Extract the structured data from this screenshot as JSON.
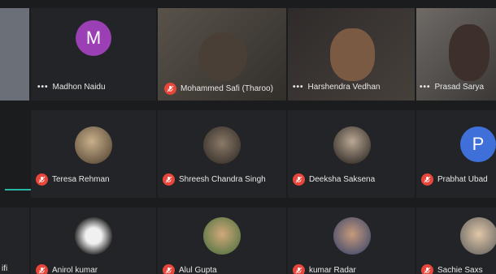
{
  "participants": [
    {
      "id": "p0",
      "name": "",
      "kind": "video",
      "status": "none"
    },
    {
      "id": "p1",
      "name": "Madhon Naidu",
      "kind": "letter",
      "letter": "M",
      "avatar_color": "#9b3fb4",
      "status": "more"
    },
    {
      "id": "p2",
      "name": "Mohammed Safi (Tharoo)",
      "kind": "video",
      "status": "muted"
    },
    {
      "id": "p3",
      "name": "Harshendra Vedhan",
      "kind": "video",
      "status": "more"
    },
    {
      "id": "p4",
      "name": "Prasad Sarya",
      "kind": "video",
      "status": "more"
    },
    {
      "id": "p5",
      "name": "Teresa Rehman",
      "kind": "photo",
      "status": "muted"
    },
    {
      "id": "p6",
      "name": "Shreesh Chandra Singh",
      "kind": "photo",
      "status": "muted"
    },
    {
      "id": "p7",
      "name": "Deeksha Saksena",
      "kind": "photo",
      "status": "muted"
    },
    {
      "id": "p8",
      "name": "Prabhat Ubad",
      "kind": "letter",
      "letter": "P",
      "avatar_color": "#3f6fd8",
      "status": "muted"
    },
    {
      "id": "p9",
      "name": "Anirol kumar",
      "kind": "photo",
      "status": "muted"
    },
    {
      "id": "p10",
      "name": "Alul Gupta",
      "kind": "photo",
      "status": "muted"
    },
    {
      "id": "p11",
      "name": "kumar Radar",
      "kind": "photo",
      "status": "muted"
    },
    {
      "id": "p12",
      "name": "Sachie Saxs",
      "kind": "photo",
      "status": "muted"
    },
    {
      "id": "p13",
      "name": "ifi",
      "kind": "none",
      "status": "none"
    }
  ],
  "icons": {
    "mute": "microphone-off-icon",
    "more": "more-options-icon"
  },
  "colors": {
    "background": "#1b1c1e",
    "tile": "#232427",
    "mute_badge": "#e8463b",
    "accent_line": "#29b6a6"
  }
}
